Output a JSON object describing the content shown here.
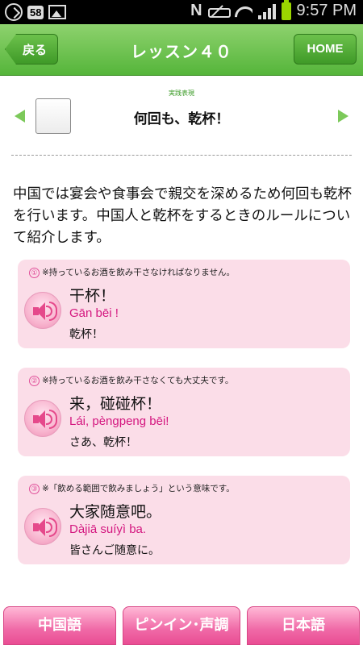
{
  "status_bar": {
    "notification_badge": "58",
    "nfc_label": "N",
    "time": "9:57 PM",
    "battery_color": "#9bd600"
  },
  "header": {
    "back_label": "戻る",
    "title": "レッスン４０",
    "home_label": "HOME",
    "accent_color": "#55b53a"
  },
  "lesson": {
    "category": "実践表現",
    "title": "何回も、乾杯！",
    "prev_icon": "triangle-left",
    "next_icon": "triangle-right"
  },
  "intro": "中国では宴会や食事会で親交を深めるため何回も乾杯を行います。中国人と乾杯をするときのルールについて紹介します。",
  "phrases": [
    {
      "number": "①",
      "note": "※持っているお酒を飲み干さなければなりません。",
      "chinese": "干杯！",
      "pinyin": "Gān bēi !",
      "japanese": "乾杯！"
    },
    {
      "number": "②",
      "note": "※持っているお酒を飲み干さなくても大丈夫です。",
      "chinese": "来，碰碰杯！",
      "pinyin": "Lái, pèngpeng bēi!",
      "japanese": "さあ、乾杯！"
    },
    {
      "number": "③",
      "note": "※「飲める範囲で飲みましょう」という意味です。",
      "chinese": "大家随意吧。",
      "pinyin": "Dàjiā suíyì ba.",
      "japanese": "皆さんご随意に。"
    }
  ],
  "tabs": [
    {
      "label": "中国語"
    },
    {
      "label": "ピンイン･声調"
    },
    {
      "label": "日本語"
    }
  ],
  "colors": {
    "card_background": "#fbdde8",
    "pinyin": "#d4167f",
    "tab": "#f06aa7"
  }
}
